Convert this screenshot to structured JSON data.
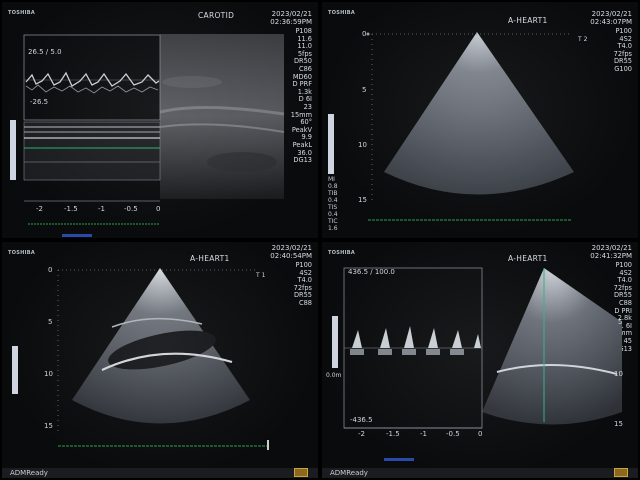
{
  "panels": {
    "tl": {
      "brand": "TOSHIBA",
      "title": "CAROTID",
      "date": "2023/02/21",
      "time": "02:36:59PM",
      "params": [
        "P108",
        "11.6",
        "11.0",
        "5fps",
        "DR50",
        "C86",
        "MD60",
        "D PRF",
        "1.3k",
        "D 6I",
        "23",
        "15mm",
        "60°",
        "PeakV",
        "9.9",
        "PeakL",
        "36.0",
        "DG13"
      ],
      "doppler_scale_top": "26.5 / 5.0",
      "doppler_scale_bottom": "-26.5",
      "time_ticks": [
        "-2",
        "-1.5",
        "-1",
        "-0.5",
        "0"
      ]
    },
    "tr": {
      "brand": "TOSHIBA",
      "title": "A-HEART1",
      "date": "2023/02/21",
      "time": "02:43:07PM",
      "params": [
        "P100",
        "4S2",
        "T4.0",
        "72fps",
        "DR55",
        "G100"
      ],
      "probe_mark": "T 2",
      "depth_ticks": [
        "0",
        "5",
        "10",
        "15"
      ],
      "low_params": [
        "MI",
        "0.8",
        "TIB",
        "0.4",
        "TIS",
        "0.4",
        "TIC",
        "1.6"
      ]
    },
    "bl": {
      "brand": "TOSHIBA",
      "title": "A-HEART1",
      "date": "2023/02/21",
      "time": "02:40:54PM",
      "params": [
        "P100",
        "4S2",
        "T4.0",
        "72fps",
        "DR55",
        "C88"
      ],
      "probe_mark": "T 1",
      "depth_ticks": [
        "0",
        "5",
        "10",
        "15"
      ],
      "status": "ADMReady"
    },
    "br": {
      "brand": "TOSHIBA",
      "title": "A-HEART1",
      "date": "2023/02/21",
      "time": "02:41:32PM",
      "params": [
        "P100",
        "4S2",
        "T4.0",
        "72fps",
        "DR55",
        "C88",
        "D PRI",
        "2.8k",
        "11 6I",
        "75mm",
        "45",
        "DG13"
      ],
      "doppler_scale_top": "436.5 / 100.0",
      "doppler_scale_bottom": "-436.5",
      "doppler_mid_label": "0.0m",
      "time_ticks": [
        "-2",
        "-1.5",
        "-1",
        "-0.5",
        "0"
      ],
      "depth_ticks": [
        "5",
        "10",
        "15"
      ],
      "status": "ADMReady"
    }
  }
}
